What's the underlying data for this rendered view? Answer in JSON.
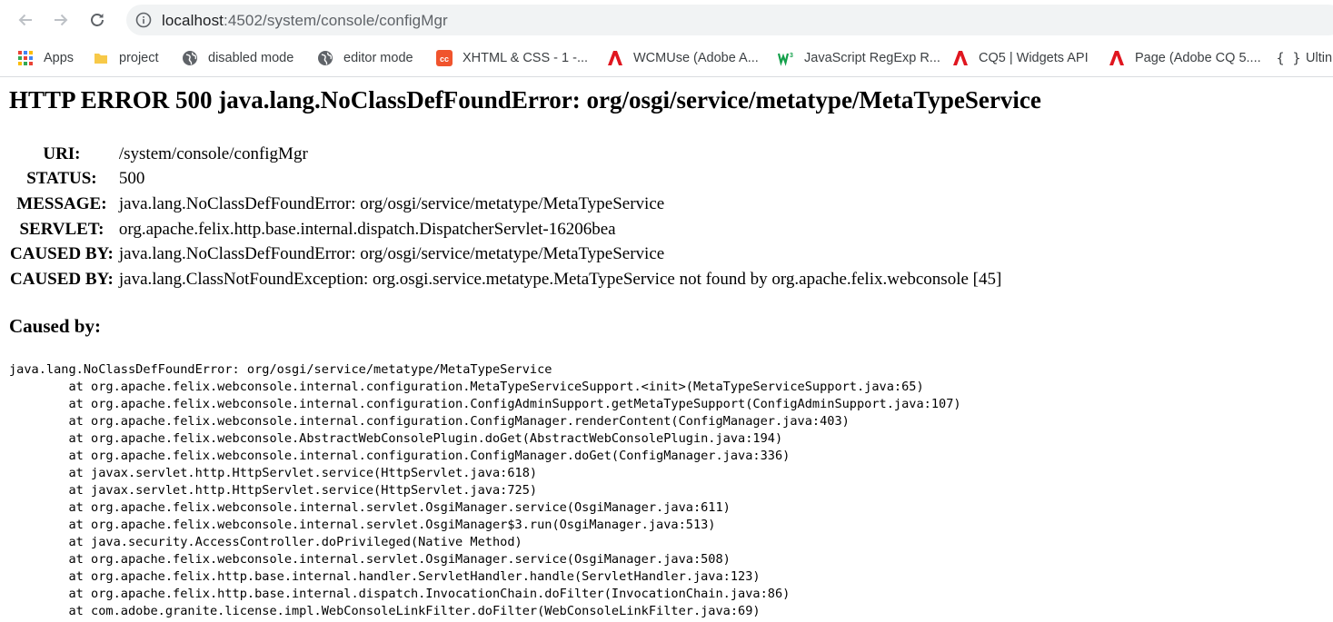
{
  "browser": {
    "url_host": "localhost",
    "url_rest": ":4502/system/console/configMgr"
  },
  "bookmarks": [
    {
      "label": "Apps",
      "icon": "apps-grid-icon"
    },
    {
      "label": "project",
      "icon": "folder-icon"
    },
    {
      "label": "disabled mode",
      "icon": "globe-icon"
    },
    {
      "label": "editor mode",
      "icon": "globe-icon"
    },
    {
      "label": "XHTML & CSS - 1 -...",
      "icon": "cc-logo-icon"
    },
    {
      "label": "WCMUse (Adobe A...",
      "icon": "adobe-icon"
    },
    {
      "label": "JavaScript RegExp R...",
      "icon": "w3schools-icon"
    },
    {
      "label": "CQ5 | Widgets API",
      "icon": "adobe-icon"
    },
    {
      "label": "Page (Adobe CQ 5....",
      "icon": "adobe-icon"
    },
    {
      "label": "Ultin",
      "icon": "braces-icon"
    }
  ],
  "error": {
    "title": "HTTP ERROR 500 java.lang.NoClassDefFoundError: org/osgi/service/metatype/MetaTypeService",
    "rows": [
      {
        "label": "URI:",
        "value": "/system/console/configMgr"
      },
      {
        "label": "STATUS:",
        "value": "500"
      },
      {
        "label": "MESSAGE:",
        "value": "java.lang.NoClassDefFoundError: org/osgi/service/metatype/MetaTypeService"
      },
      {
        "label": "SERVLET:",
        "value": "org.apache.felix.http.base.internal.dispatch.DispatcherServlet-16206bea"
      },
      {
        "label": "CAUSED BY:",
        "value": "java.lang.NoClassDefFoundError: org/osgi/service/metatype/MetaTypeService"
      },
      {
        "label": "CAUSED BY:",
        "value": "java.lang.ClassNotFoundException: org.osgi.service.metatype.MetaTypeService not found by org.apache.felix.webconsole [45]"
      }
    ],
    "caused_by_heading": "Caused by:",
    "stack_trace": [
      "java.lang.NoClassDefFoundError: org/osgi/service/metatype/MetaTypeService",
      "\tat org.apache.felix.webconsole.internal.configuration.MetaTypeServiceSupport.<init>(MetaTypeServiceSupport.java:65)",
      "\tat org.apache.felix.webconsole.internal.configuration.ConfigAdminSupport.getMetaTypeSupport(ConfigAdminSupport.java:107)",
      "\tat org.apache.felix.webconsole.internal.configuration.ConfigManager.renderContent(ConfigManager.java:403)",
      "\tat org.apache.felix.webconsole.AbstractWebConsolePlugin.doGet(AbstractWebConsolePlugin.java:194)",
      "\tat org.apache.felix.webconsole.internal.configuration.ConfigManager.doGet(ConfigManager.java:336)",
      "\tat javax.servlet.http.HttpServlet.service(HttpServlet.java:618)",
      "\tat javax.servlet.http.HttpServlet.service(HttpServlet.java:725)",
      "\tat org.apache.felix.webconsole.internal.servlet.OsgiManager.service(OsgiManager.java:611)",
      "\tat org.apache.felix.webconsole.internal.servlet.OsgiManager$3.run(OsgiManager.java:513)",
      "\tat java.security.AccessController.doPrivileged(Native Method)",
      "\tat org.apache.felix.webconsole.internal.servlet.OsgiManager.service(OsgiManager.java:508)",
      "\tat org.apache.felix.http.base.internal.handler.ServletHandler.handle(ServletHandler.java:123)",
      "\tat org.apache.felix.http.base.internal.dispatch.InvocationChain.doFilter(InvocationChain.java:86)",
      "\tat com.adobe.granite.license.impl.WebConsoleLinkFilter.doFilter(WebConsoleLinkFilter.java:69)"
    ]
  }
}
